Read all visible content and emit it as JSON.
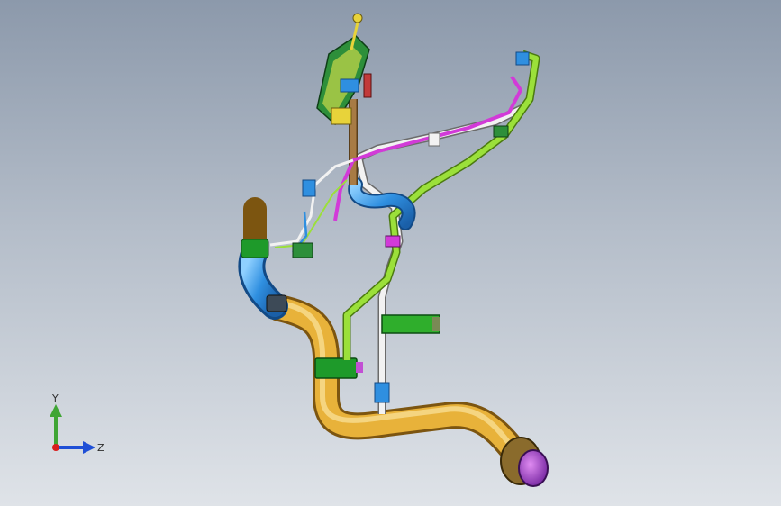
{
  "viewport": {
    "background_top": "#8c99ab",
    "background_bottom": "#dfe3e8"
  },
  "triad": {
    "y_label": "Y",
    "z_label": "Z",
    "y_color": "#3fa535",
    "z_color": "#1f4fd6",
    "x_color": "#d81e1e"
  },
  "model": {
    "parts": [
      "pipe-orange-main",
      "pipe-blue-elbow",
      "pipe-green-line",
      "pipe-white-line",
      "pipe-magenta-line",
      "pipe-brown-riser",
      "pipe-blue-loop",
      "bracket-green",
      "clamp-green",
      "filler-neck-purple",
      "connector-cluster-top"
    ],
    "colors": {
      "orange": "#e8b23a",
      "blue": "#2f8fe0",
      "green": "#9be03a",
      "white": "#f2f2f2",
      "magenta": "#d23ad8",
      "brown": "#a87b44",
      "purple": "#9b3fcf",
      "dark_green": "#1e9a2a"
    }
  }
}
